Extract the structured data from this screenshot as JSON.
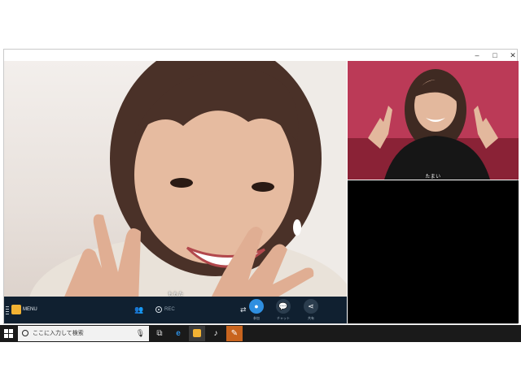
{
  "window": {
    "controls": {
      "minimize": "–",
      "maximize": "□",
      "close": "✕"
    }
  },
  "main_video": {
    "caption": "ももた"
  },
  "side_video": {
    "caption": "たまい"
  },
  "toolbar": {
    "menu_label": "MENU",
    "participants_icon": "👥",
    "rec_label": "REC",
    "switch_icon": "⇄",
    "participants_button_sub": "参加",
    "chat_button_sub": "チャット",
    "share_button_sub": "共有",
    "accent": "#2f8fe0"
  },
  "taskbar": {
    "search_placeholder": "ここに入力して検索",
    "apps": [
      "task-view-icon",
      "edge-icon",
      "video-app-icon",
      "itunes-icon",
      "paint-icon"
    ]
  }
}
